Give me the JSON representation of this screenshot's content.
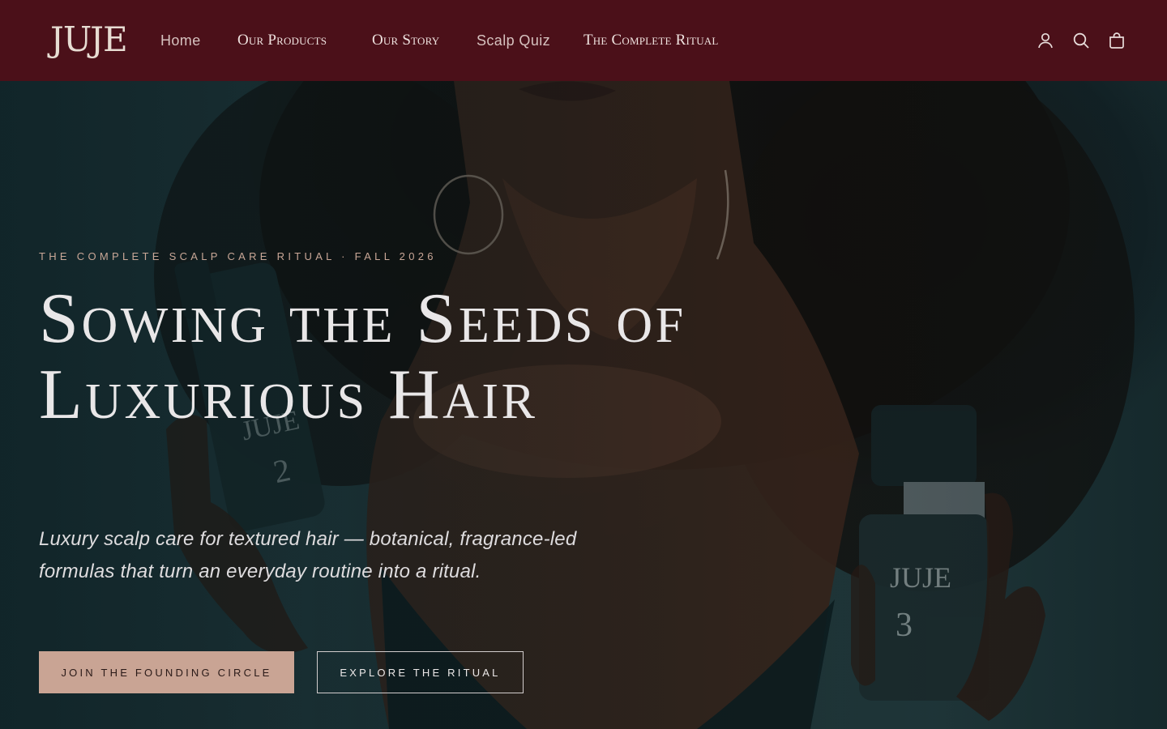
{
  "brand": {
    "logo_text": "JUJE"
  },
  "nav": {
    "items": [
      {
        "label": "Home"
      },
      {
        "label": "Our Products"
      },
      {
        "label": "Our Story"
      },
      {
        "label": "Scalp Quiz"
      },
      {
        "label": "The Complete Ritual"
      }
    ]
  },
  "header_icons": [
    "account-icon",
    "search-icon",
    "cart-icon"
  ],
  "hero": {
    "eyebrow": "THE COMPLETE SCALP CARE RITUAL · FALL 2026",
    "headline": "Sowing the Seeds of Luxurious Hair",
    "subhead": "Luxury scalp care for textured hair — botanical, fragrance-led formulas that turn an everyday routine into a ritual.",
    "primary_cta": "JOIN THE FOUNDING CIRCLE",
    "secondary_cta": "EXPLORE THE RITUAL",
    "bottle_left": {
      "brand": "JUJE",
      "number": "№2"
    },
    "bottle_right": {
      "brand": "JUJE",
      "number": "№3"
    }
  },
  "colors": {
    "header_bg": "#4b1019",
    "primary_button": "#c9a494",
    "eyebrow": "#c9a797",
    "hero_bg": "#1d3235"
  }
}
